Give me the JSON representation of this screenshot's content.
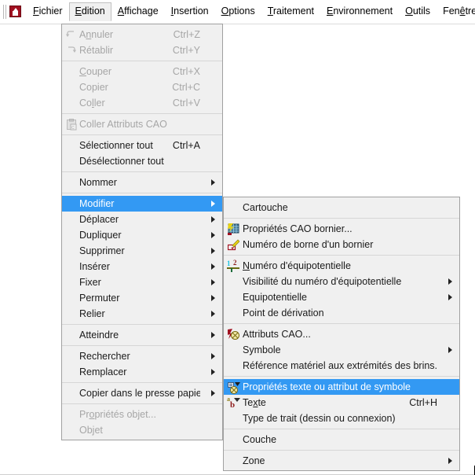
{
  "colors": {
    "menu_bg": "#f0f0f0",
    "menu_border": "#a0a0a0",
    "highlight": "#3399f3",
    "highlight_text": "#ffffff",
    "text": "#1a1a1a",
    "disabled_text": "#a6a6a6",
    "separator": "#d6d6d6",
    "app_icon_red": "#a01020"
  },
  "menubar": {
    "app_icon": "red-page-up-arrow-icon",
    "items": [
      {
        "label": "Fichier",
        "accesskey": "F",
        "open": false
      },
      {
        "label": "Edition",
        "accesskey": "E",
        "open": true
      },
      {
        "label": "Affichage",
        "accesskey": "A",
        "open": false
      },
      {
        "label": "Insertion",
        "accesskey": "I",
        "open": false
      },
      {
        "label": "Options",
        "accesskey": "O",
        "open": false
      },
      {
        "label": "Traitement",
        "accesskey": "T",
        "open": false
      },
      {
        "label": "Environnement",
        "accesskey": "E",
        "open": false
      },
      {
        "label": "Outils",
        "accesskey": "O",
        "open": false
      },
      {
        "label": "Fenêtre",
        "accesskey": "ê",
        "open": false
      },
      {
        "label": "<?>",
        "accesskey": "?",
        "open": false
      }
    ]
  },
  "edition_menu": {
    "name": "Edition",
    "items": [
      {
        "label": "Annuler",
        "accel": "Ctrl+Z",
        "icon": "undo-icon",
        "disabled": true,
        "submenu": false,
        "selected": false
      },
      {
        "label": "Rétablir",
        "accel": "Ctrl+Y",
        "icon": "redo-icon",
        "disabled": true,
        "submenu": false,
        "selected": false
      },
      {
        "separator": true
      },
      {
        "label": "Couper",
        "accel": "Ctrl+X",
        "icon": "",
        "disabled": true,
        "submenu": false,
        "selected": false
      },
      {
        "label": "Copier",
        "accel": "Ctrl+C",
        "icon": "",
        "disabled": true,
        "submenu": false,
        "selected": false
      },
      {
        "label": "Coller",
        "accel": "Ctrl+V",
        "icon": "",
        "disabled": true,
        "submenu": false,
        "selected": false
      },
      {
        "separator": true
      },
      {
        "label": "Coller Attributs CAO",
        "accel": "",
        "icon": "clipboard-cao-icon",
        "disabled": true,
        "submenu": false,
        "selected": false
      },
      {
        "separator": true
      },
      {
        "label": "Sélectionner tout",
        "accel": "Ctrl+A",
        "icon": "",
        "disabled": false,
        "submenu": false,
        "selected": false
      },
      {
        "label": "Désélectionner tout",
        "accel": "",
        "icon": "",
        "disabled": false,
        "submenu": false,
        "selected": false
      },
      {
        "separator": true
      },
      {
        "label": "Nommer",
        "accel": "",
        "icon": "",
        "disabled": false,
        "submenu": true,
        "selected": false
      },
      {
        "separator": true
      },
      {
        "label": "Modifier",
        "accel": "",
        "icon": "",
        "disabled": false,
        "submenu": true,
        "selected": true
      },
      {
        "label": "Déplacer",
        "accel": "",
        "icon": "",
        "disabled": false,
        "submenu": true,
        "selected": false
      },
      {
        "label": "Dupliquer",
        "accel": "",
        "icon": "",
        "disabled": false,
        "submenu": true,
        "selected": false
      },
      {
        "label": "Supprimer",
        "accel": "",
        "icon": "",
        "disabled": false,
        "submenu": true,
        "selected": false
      },
      {
        "label": "Insérer",
        "accel": "",
        "icon": "",
        "disabled": false,
        "submenu": true,
        "selected": false
      },
      {
        "label": "Fixer",
        "accel": "",
        "icon": "",
        "disabled": false,
        "submenu": true,
        "selected": false
      },
      {
        "label": "Permuter",
        "accel": "",
        "icon": "",
        "disabled": false,
        "submenu": true,
        "selected": false
      },
      {
        "label": "Relier",
        "accel": "",
        "icon": "",
        "disabled": false,
        "submenu": true,
        "selected": false
      },
      {
        "separator": true
      },
      {
        "label": "Atteindre",
        "accel": "",
        "icon": "",
        "disabled": false,
        "submenu": true,
        "selected": false
      },
      {
        "separator": true
      },
      {
        "label": "Rechercher",
        "accel": "",
        "icon": "",
        "disabled": false,
        "submenu": true,
        "selected": false
      },
      {
        "label": "Remplacer",
        "accel": "",
        "icon": "",
        "disabled": false,
        "submenu": true,
        "selected": false
      },
      {
        "separator": true
      },
      {
        "label": "Copier dans le presse papier",
        "accel": "",
        "icon": "",
        "disabled": false,
        "submenu": true,
        "selected": false
      },
      {
        "separator": true
      },
      {
        "label": "Propriétés objet...",
        "accel": "",
        "icon": "",
        "disabled": true,
        "submenu": false,
        "selected": false
      },
      {
        "label": "Objet",
        "accel": "",
        "icon": "",
        "disabled": true,
        "submenu": false,
        "selected": false
      }
    ]
  },
  "modifier_menu": {
    "name": "Modifier",
    "items": [
      {
        "label": "Cartouche",
        "accel": "",
        "icon": "",
        "disabled": false,
        "submenu": false,
        "selected": false
      },
      {
        "separator": true
      },
      {
        "label": "Propriétés CAO bornier...",
        "accel": "",
        "icon": "terminal-block-cao-icon",
        "disabled": false,
        "submenu": false,
        "selected": false
      },
      {
        "label": "Numéro de borne d'un bornier",
        "accel": "",
        "icon": "terminal-number-icon",
        "disabled": false,
        "submenu": false,
        "selected": false
      },
      {
        "separator": true
      },
      {
        "label": "Numéro d'équipotentielle",
        "accel": "",
        "icon": "equipotential-number-icon",
        "disabled": false,
        "submenu": false,
        "selected": false
      },
      {
        "label": "Visibilité du numéro d'équipotentielle",
        "accel": "",
        "icon": "",
        "disabled": false,
        "submenu": true,
        "selected": false
      },
      {
        "label": "Equipotentielle",
        "accel": "",
        "icon": "",
        "disabled": false,
        "submenu": true,
        "selected": false
      },
      {
        "label": "Point de dérivation",
        "accel": "",
        "icon": "",
        "disabled": false,
        "submenu": false,
        "selected": false
      },
      {
        "separator": true
      },
      {
        "label": "Attributs CAO...",
        "accel": "",
        "icon": "cao-attributes-icon",
        "disabled": false,
        "submenu": false,
        "selected": false
      },
      {
        "label": "Symbole",
        "accel": "",
        "icon": "",
        "disabled": false,
        "submenu": true,
        "selected": false
      },
      {
        "label": "Référence matériel aux extrémités des brins...",
        "accel": "",
        "icon": "",
        "disabled": false,
        "submenu": false,
        "selected": false
      },
      {
        "separator": true
      },
      {
        "label": "Propriétés texte ou attribut de symbole",
        "accel": "",
        "icon": "text-properties-icon",
        "disabled": false,
        "submenu": false,
        "selected": true
      },
      {
        "label": "Texte",
        "accel": "Ctrl+H",
        "icon": "text-ab-icon",
        "disabled": false,
        "submenu": false,
        "selected": false
      },
      {
        "label": "Type de trait (dessin ou connexion)",
        "accel": "",
        "icon": "",
        "disabled": false,
        "submenu": false,
        "selected": false
      },
      {
        "separator": true
      },
      {
        "label": "Couche",
        "accel": "",
        "icon": "",
        "disabled": false,
        "submenu": false,
        "selected": false
      },
      {
        "separator": true
      },
      {
        "label": "Zone",
        "accel": "",
        "icon": "",
        "disabled": false,
        "submenu": true,
        "selected": false
      }
    ]
  }
}
